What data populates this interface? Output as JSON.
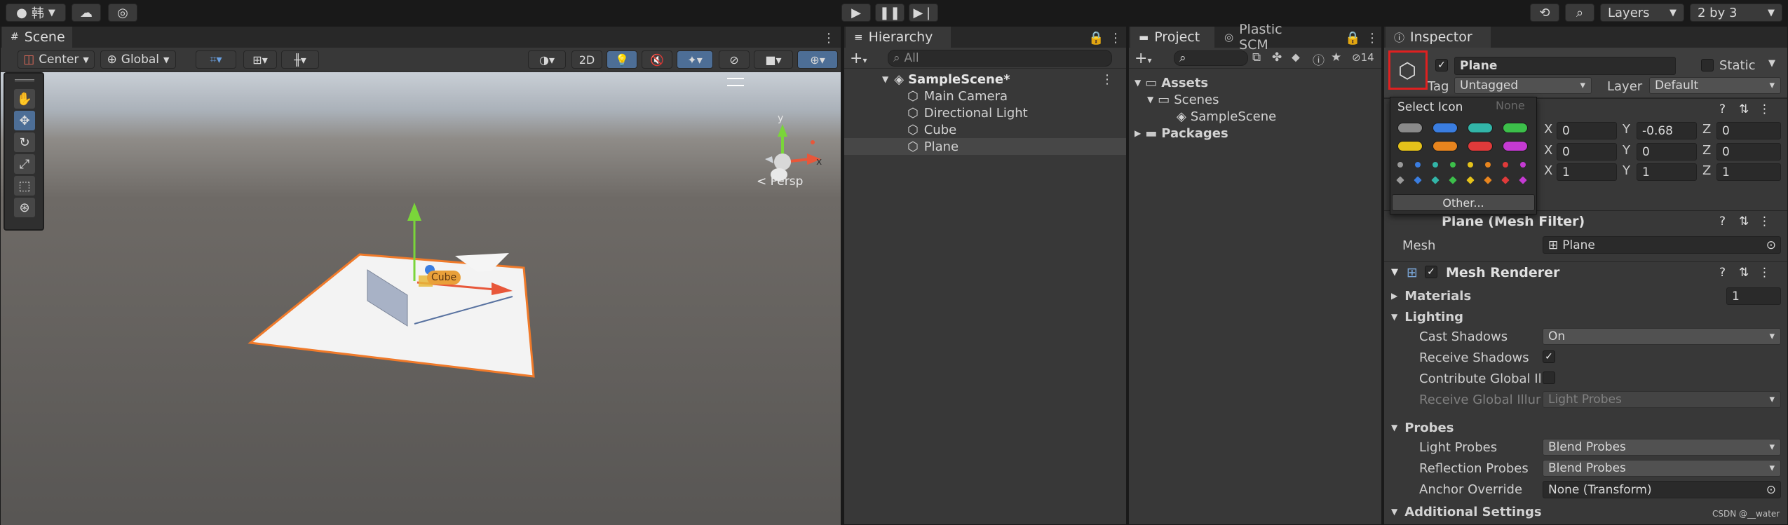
{
  "toolbar": {
    "account_label": "韩",
    "layers_label": "Layers",
    "layout_label": "2 by 3",
    "play_icon": "play-icon",
    "pause_icon": "pause-icon",
    "step_icon": "step-icon"
  },
  "scene": {
    "tab_label": "Scene",
    "pivot_label": "Center",
    "space_label": "Global",
    "mode_2d": "2D",
    "persp_label": "Persp",
    "cube_label": "Cube"
  },
  "hierarchy": {
    "tab_label": "Hierarchy",
    "search_placeholder": "All",
    "scene_name": "SampleScene*",
    "items": [
      "Main Camera",
      "Directional Light",
      "Cube",
      "Plane"
    ]
  },
  "project": {
    "tab_label": "Project",
    "tab2_label": "Plastic SCM",
    "hidden_count": "14",
    "tree": {
      "assets": "Assets",
      "scenes": "Scenes",
      "sample_scene": "SampleScene",
      "packages": "Packages"
    }
  },
  "inspector": {
    "tab_label": "Inspector",
    "object_name": "Plane",
    "static_label": "Static",
    "tag_label": "Tag",
    "tag_value": "Untagged",
    "layer_label": "Layer",
    "layer_value": "Default",
    "transform": {
      "position": {
        "x": "0",
        "y": "-0.68",
        "z": "0"
      },
      "rotation": {
        "x": "0",
        "y": "0",
        "z": "0"
      },
      "scale": {
        "x": "1",
        "y": "1",
        "z": "1"
      }
    },
    "mesh_filter_title": "Plane (Mesh Filter)",
    "mesh_label": "Mesh",
    "mesh_value": "Plane",
    "mesh_renderer_title": "Mesh Renderer",
    "materials_label": "Materials",
    "materials_count": "1",
    "lighting_label": "Lighting",
    "cast_shadows_label": "Cast Shadows",
    "cast_shadows_value": "On",
    "receive_shadows_label": "Receive Shadows",
    "contribute_gi_label": "Contribute Global Ill",
    "receive_gi_label": "Receive Global Illur",
    "receive_gi_value": "Light Probes",
    "probes_label": "Probes",
    "light_probes_label": "Light Probes",
    "light_probes_value": "Blend Probes",
    "reflection_probes_label": "Reflection Probes",
    "reflection_probes_value": "Blend Probes",
    "anchor_override_label": "Anchor Override",
    "anchor_override_value": "None (Transform)",
    "additional_settings_label": "Additional Settings"
  },
  "icon_popup": {
    "title": "Select Icon",
    "none_label": "None",
    "other_button": "Other...",
    "label_colors": [
      "#8a8a8a",
      "#3a7de0",
      "#32b5a8",
      "#3cbf4a",
      "#e5c21a",
      "#e8851e",
      "#e03a3a",
      "#c43ad2"
    ],
    "dot_colors": [
      "#9a9a9a",
      "#3a7de0",
      "#32b5a8",
      "#3cbf4a",
      "#e5c21a",
      "#e8851e",
      "#e03a3a",
      "#c43ad2"
    ]
  },
  "watermark": "CSDN @__water",
  "colors": {
    "highlight": "#e02020",
    "accent_blue": "#3a72b0"
  }
}
